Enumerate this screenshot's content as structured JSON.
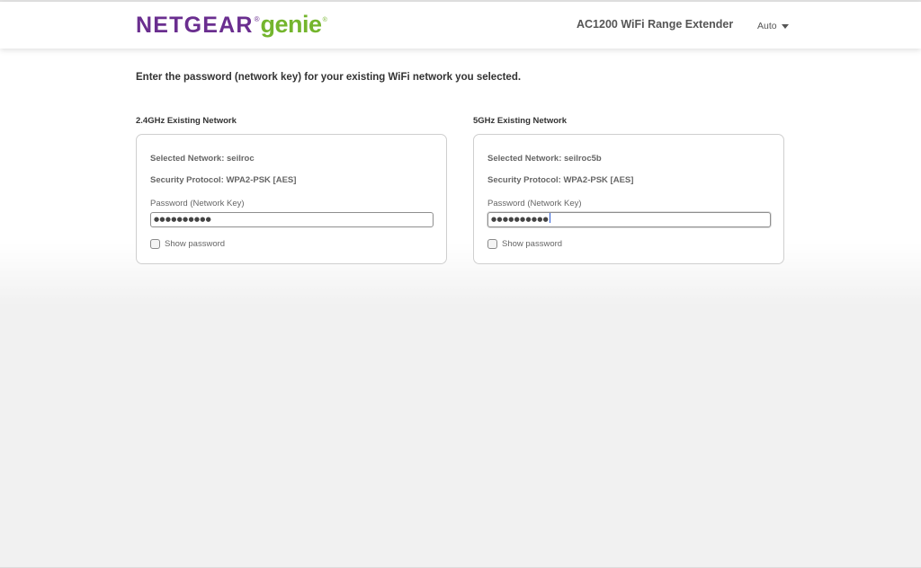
{
  "header": {
    "logo_brand": "NETGEAR",
    "logo_reg": "®",
    "logo_product": "genie",
    "logo_tm": "®",
    "product_name": "AC1200 WiFi Range Extender",
    "language": "Auto"
  },
  "instruction": "Enter the password (network key) for your existing WiFi network you selected.",
  "networks": [
    {
      "section_label": "2.4GHz Existing Network",
      "selected_network": "Selected Network: seilroc",
      "security_protocol": "Security Protocol: WPA2-PSK [AES]",
      "password_label": "Password (Network Key)",
      "password_masked": "●●●●●●●●●●",
      "show_password_label": "Show password",
      "show_password_checked": false
    },
    {
      "section_label": "5GHz Existing Network",
      "selected_network": "Selected Network: seilroc5b",
      "security_protocol": "Security Protocol: WPA2-PSK [AES]",
      "password_label": "Password (Network Key)",
      "password_masked": "●●●●●●●●●●",
      "show_password_label": "Show password",
      "show_password_checked": false
    }
  ],
  "colors": {
    "brand_purple": "#6a2e8f",
    "brand_green": "#74b52d",
    "cursor_blue": "#2a5bd7"
  },
  "icons": {
    "language_dropdown": "caret-down-icon"
  }
}
